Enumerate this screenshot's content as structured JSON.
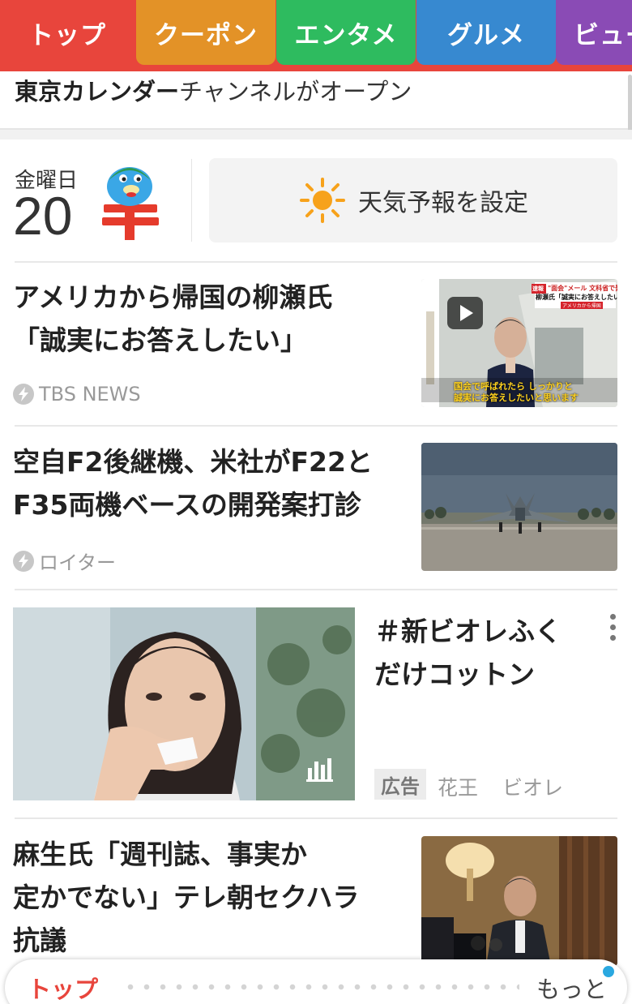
{
  "tabs": [
    {
      "label": "トップ",
      "color": "#e8453c"
    },
    {
      "label": "クーポン",
      "color": "#e39227"
    },
    {
      "label": "エンタメ",
      "color": "#2ebb5f"
    },
    {
      "label": "グルメ",
      "color": "#3789d0"
    },
    {
      "label": "ビュー",
      "color": "#8a4bb5"
    }
  ],
  "banner": {
    "bold": "東京カレンダー",
    "rest": "チャンネルがオープン"
  },
  "date": {
    "weekday": "金曜日",
    "day": "20"
  },
  "weather": {
    "label": "天気予報を設定",
    "icon": "sun-icon"
  },
  "articles": [
    {
      "title_lines": [
        "アメリカから帰国の柳瀬氏",
        "「誠実にお答えしたい」"
      ],
      "source": "TBS NEWS",
      "thumb": "video-thumbnail",
      "overlay": {
        "top": "\"面会\"メール 文科省で発",
        "mid": "柳瀬氏「誠実にお答えしたい",
        "sub": "アメリカから帰国",
        "caption1": "国会で呼ばれたら しっかりと",
        "caption2": "誠実にお答えしたいと思います",
        "badge": "速報"
      }
    },
    {
      "title_lines": [
        "空自F2後継機、米社がF22と",
        "F35両機ベースの開発案打診"
      ],
      "source": "ロイター",
      "thumb": "jet-photo"
    },
    {
      "title_lines": [
        "麻生氏「週刊誌、事実か",
        "定かでない」テレ朝セクハラ",
        "抗議"
      ],
      "source": "",
      "thumb": "press-photo"
    }
  ],
  "ad": {
    "title_lines": [
      "＃新ビオレふく",
      "だけコットン"
    ],
    "badge": "広告",
    "advertiser": "花王",
    "brand": "ビオレ"
  },
  "bottom_nav": {
    "top_label": "トップ",
    "more_label": "もっと"
  }
}
